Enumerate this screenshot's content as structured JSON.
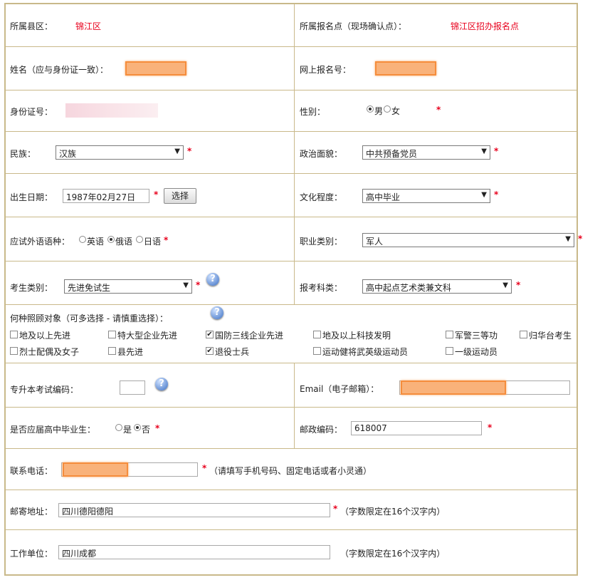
{
  "county": {
    "label": "所属县区：",
    "value": "锦江区"
  },
  "site": {
    "label": "所属报名点（现场确认点）：",
    "value": "锦江区招办报名点"
  },
  "name": {
    "label": "姓名（应与身份证一致）："
  },
  "online_no": {
    "label": "网上报名号："
  },
  "id_card": {
    "label": "身份证号："
  },
  "gender": {
    "label": "性别：",
    "options": [
      "男",
      "女"
    ],
    "selected": "男"
  },
  "ethnicity": {
    "label": "民族：",
    "value": "汉族"
  },
  "politics": {
    "label": "政治面貌：",
    "value": "中共预备党员"
  },
  "birth": {
    "label": "出生日期：",
    "value": "1987年02月27日",
    "button": "选择"
  },
  "education": {
    "label": "文化程度：",
    "value": "高中毕业"
  },
  "language": {
    "label": "应试外语语种：",
    "options": [
      "英语",
      "俄语",
      "日语"
    ],
    "selected": "俄语"
  },
  "occupation": {
    "label": "职业类别：",
    "value": "军人"
  },
  "candidate_type": {
    "label": "考生类别：",
    "value": "先进免试生"
  },
  "subject": {
    "label": "报考科类：",
    "value": "高中起点艺术类兼文科"
  },
  "care": {
    "label": "何种照顾对象（可多选择 - 请慎重选择）：",
    "row1": [
      {
        "text": "地及以上先进",
        "checked": false
      },
      {
        "text": "特大型企业先进",
        "checked": false
      },
      {
        "text": "国防三线企业先进",
        "checked": true
      },
      {
        "text": "地及以上科技发明",
        "checked": false
      },
      {
        "text": "军警三等功",
        "checked": false
      },
      {
        "text": "归华台考生",
        "checked": false
      }
    ],
    "row2": [
      {
        "text": "烈士配偶及女子",
        "checked": false
      },
      {
        "text": "县先进",
        "checked": false
      },
      {
        "text": "退役士兵",
        "checked": true
      },
      {
        "text": "运动健将武英级运动员",
        "checked": false
      },
      {
        "text": "一级运动员",
        "checked": false
      }
    ]
  },
  "upgrade_code": {
    "label": "专升本考试编码："
  },
  "email": {
    "label": "Email（电子邮箱）："
  },
  "fresh_grad": {
    "label": "是否应届高中毕业生：",
    "options": [
      "是",
      "否"
    ],
    "selected": "否"
  },
  "postcode": {
    "label": "邮政编码：",
    "value": "618007"
  },
  "phone": {
    "label": "联系电话：",
    "hint": "（请填写手机号码、固定电话或者小灵通）"
  },
  "address": {
    "label": "邮寄地址：",
    "value": "四川德阳德阳",
    "hint": "（字数限定在16个汉字内）"
  },
  "employer": {
    "label": "工作单位：",
    "value": "四川成都",
    "hint": "（字数限定在16个汉字内）"
  },
  "symbols": {
    "required": "*",
    "help": "?",
    "arrow": "▼",
    "check": "✔"
  },
  "colors": {
    "border": "#c9b98a",
    "required": "#e8001c",
    "redaction": "#f9b27a"
  }
}
